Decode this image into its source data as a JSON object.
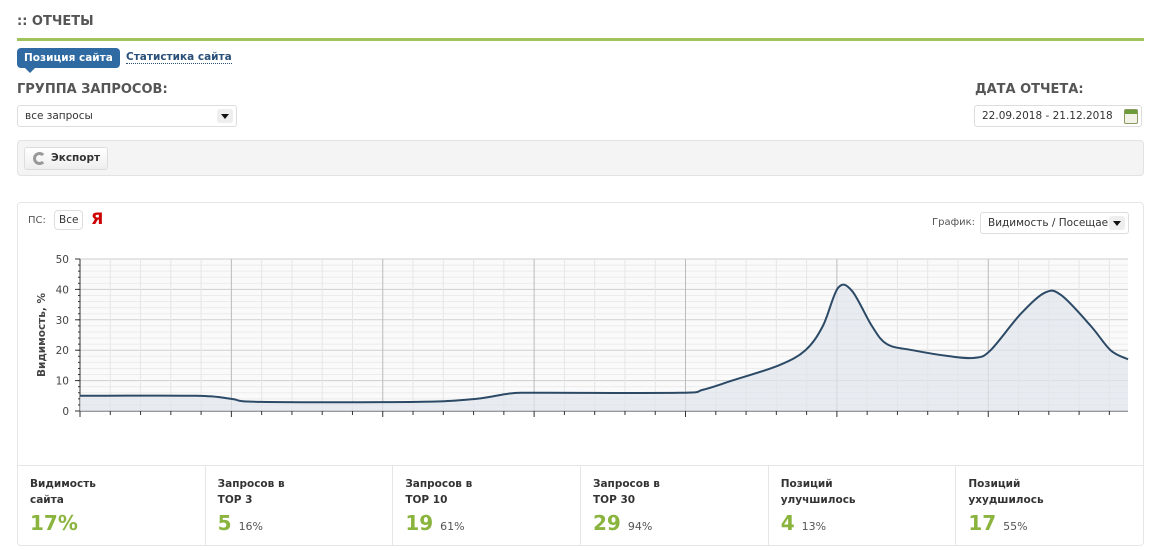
{
  "header": {
    "title": ":: ОТЧЕТЫ"
  },
  "tabs": [
    {
      "label": "Позиция сайта",
      "active": true
    },
    {
      "label": "Статистика сайта",
      "active": false
    }
  ],
  "group": {
    "label": "ГРУППА ЗАПРОСОВ:",
    "value": "все запросы"
  },
  "date": {
    "label": "ДАТА ОТЧЕТА:",
    "value": "22.09.2018 - 21.12.2018"
  },
  "toolbar": {
    "export_label": "Экспорт"
  },
  "panel": {
    "ps_label": "ПС:",
    "ps_all": "Все",
    "ps_yandex": "Я",
    "graph_label": "График:",
    "graph_value": "Видимость / Посещаемс"
  },
  "chart_data": {
    "type": "area",
    "ylabel": "Видимость, %",
    "ylim": [
      0,
      50
    ],
    "yticks": [
      0,
      10,
      20,
      30,
      40,
      50
    ],
    "xlim": [
      0,
      90
    ],
    "color": "#2c4a66",
    "x": [
      0,
      10,
      13,
      15.5,
      29,
      34,
      37,
      39.5,
      51.5,
      53.5,
      56,
      60,
      62.3,
      63.8,
      65.1,
      66.3,
      68,
      69.3,
      71.5,
      74.7,
      76.9,
      78.2,
      80.8,
      82.9,
      84.3,
      86.8,
      88.5,
      90
    ],
    "values": [
      5,
      5,
      4,
      3,
      3,
      4,
      5.8,
      6,
      6,
      7,
      10,
      15,
      20,
      28,
      40.5,
      39.5,
      28,
      22,
      20,
      18,
      17.5,
      20,
      32,
      39,
      38,
      28,
      20,
      17
    ]
  },
  "stats": [
    {
      "label": "Видимость сайта",
      "value": "17%",
      "pct": ""
    },
    {
      "label": "Запросов в ТОР 3",
      "value": "5",
      "pct": "16%"
    },
    {
      "label": "Запросов в ТОР 10",
      "value": "19",
      "pct": "61%"
    },
    {
      "label": "Запросов в ТОР 30",
      "value": "29",
      "pct": "94%"
    },
    {
      "label": "Позиций улучшилось",
      "value": "4",
      "pct": "13%"
    },
    {
      "label": "Позиций ухудшилось",
      "value": "17",
      "pct": "55%"
    }
  ]
}
